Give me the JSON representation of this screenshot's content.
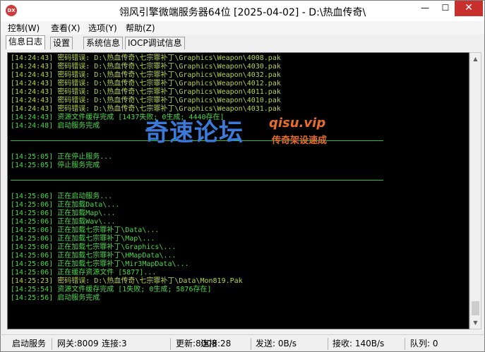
{
  "window": {
    "title": "翎风引擎微端服务器64位 [2025-04-02] - D:\\热血传奇\\",
    "icon_text": "DX",
    "min_glyph": "—",
    "max_glyph": "☐",
    "close_glyph": "✕"
  },
  "menu": {
    "items": [
      "控制(W)",
      "查看(X)",
      "选项(Y)",
      "帮助(Z)"
    ]
  },
  "tabs": {
    "items": [
      "信息日志",
      "设置",
      "系统信息",
      "IOCP调试信息"
    ],
    "active": 0
  },
  "log": {
    "lines": [
      {
        "text": "[14:24:43] 密码错误: D:\\热血传奇\\七宗罪补丁\\Graphics\\Weapon\\4008.pak",
        "color": "yellow"
      },
      {
        "text": "[14:24:43] 密码错误: D:\\热血传奇\\七宗罪补丁\\Graphics\\Weapon\\4030.pak",
        "color": "yellow"
      },
      {
        "text": "[14:24:43] 密码错误: D:\\热血传奇\\七宗罪补丁\\Graphics\\Weapon\\4032.pak",
        "color": "yellow"
      },
      {
        "text": "[14:24:43] 密码错误: D:\\热血传奇\\七宗罪补丁\\Graphics\\Weapon\\4012.pak",
        "color": "yellow"
      },
      {
        "text": "[14:24:43] 密码错误: D:\\热血传奇\\七宗罪补丁\\Graphics\\Weapon\\4011.pak",
        "color": "yellow"
      },
      {
        "text": "[14:24:43] 密码错误: D:\\热血传奇\\七宗罪补丁\\Graphics\\Weapon\\4010.pak",
        "color": "yellow"
      },
      {
        "text": "[14:24:43] 密码错误: D:\\热血传奇\\七宗罪补丁\\Graphics\\Weapon\\4031.pak",
        "color": "yellow"
      },
      {
        "text": "[14:24:43] 资源文件缓存完成 [1437失败; 0生成; 4440存在]",
        "color": "green"
      },
      {
        "text": "[14:24:48] 启动服务完成",
        "color": "green"
      },
      {
        "separator": true
      },
      {
        "text": "[14:25:05] 正在停止服务...",
        "color": "green"
      },
      {
        "text": "[14:25:05] 停止服务完成",
        "color": "green"
      },
      {
        "separator": true
      },
      {
        "text": "[14:25:06] 正在启动服务...",
        "color": "green"
      },
      {
        "text": "[14:25:06] 正在加载Data\\...",
        "color": "green"
      },
      {
        "text": "[14:25:06] 正在加载Map\\...",
        "color": "green"
      },
      {
        "text": "[14:25:06] 正在加载Wav\\...",
        "color": "green"
      },
      {
        "text": "[14:25:06] 正在加载七宗罪补丁\\Data\\...",
        "color": "green"
      },
      {
        "text": "[14:25:06] 正在加载七宗罪补丁\\Map\\...",
        "color": "green"
      },
      {
        "text": "[14:25:06] 正在加载七宗罪补丁\\Graphics\\...",
        "color": "green"
      },
      {
        "text": "[14:25:06] 正在加载七宗罪补丁\\HMapData\\...",
        "color": "green"
      },
      {
        "text": "[14:25:06] 正在加载七宗罪补丁\\Mir3MapData\\...",
        "color": "green"
      },
      {
        "text": "[14:25:06] 正在缓存资源文件 [5877]...",
        "color": "green"
      },
      {
        "text": "[14:25:23] 密码错误: D:\\热血传奇\\七宗罪补丁\\Data\\Mon819.Pak",
        "color": "yellow"
      },
      {
        "text": "[14:25:54] 资源文件缓存完成 [1失败; 0生成; 5876存在]",
        "color": "green"
      },
      {
        "text": "[14:25:56] 启动服务完成",
        "color": "green"
      }
    ],
    "colors": {
      "green": "#4cd94c",
      "yellow": "#bcd24a",
      "background": "#000000"
    }
  },
  "watermark": {
    "main": "奇速论坛",
    "url": "qisu.vip",
    "sub": "传奇架设速成"
  },
  "status": {
    "service": "启动服务",
    "gateway": "网关:8009",
    "gateway_conn": "连接:3",
    "update": "更新:8008",
    "update_conn": "连接:28",
    "send": "发送: 0B/s",
    "recv": "接收: 140B/s",
    "queue": "队列: 0"
  }
}
